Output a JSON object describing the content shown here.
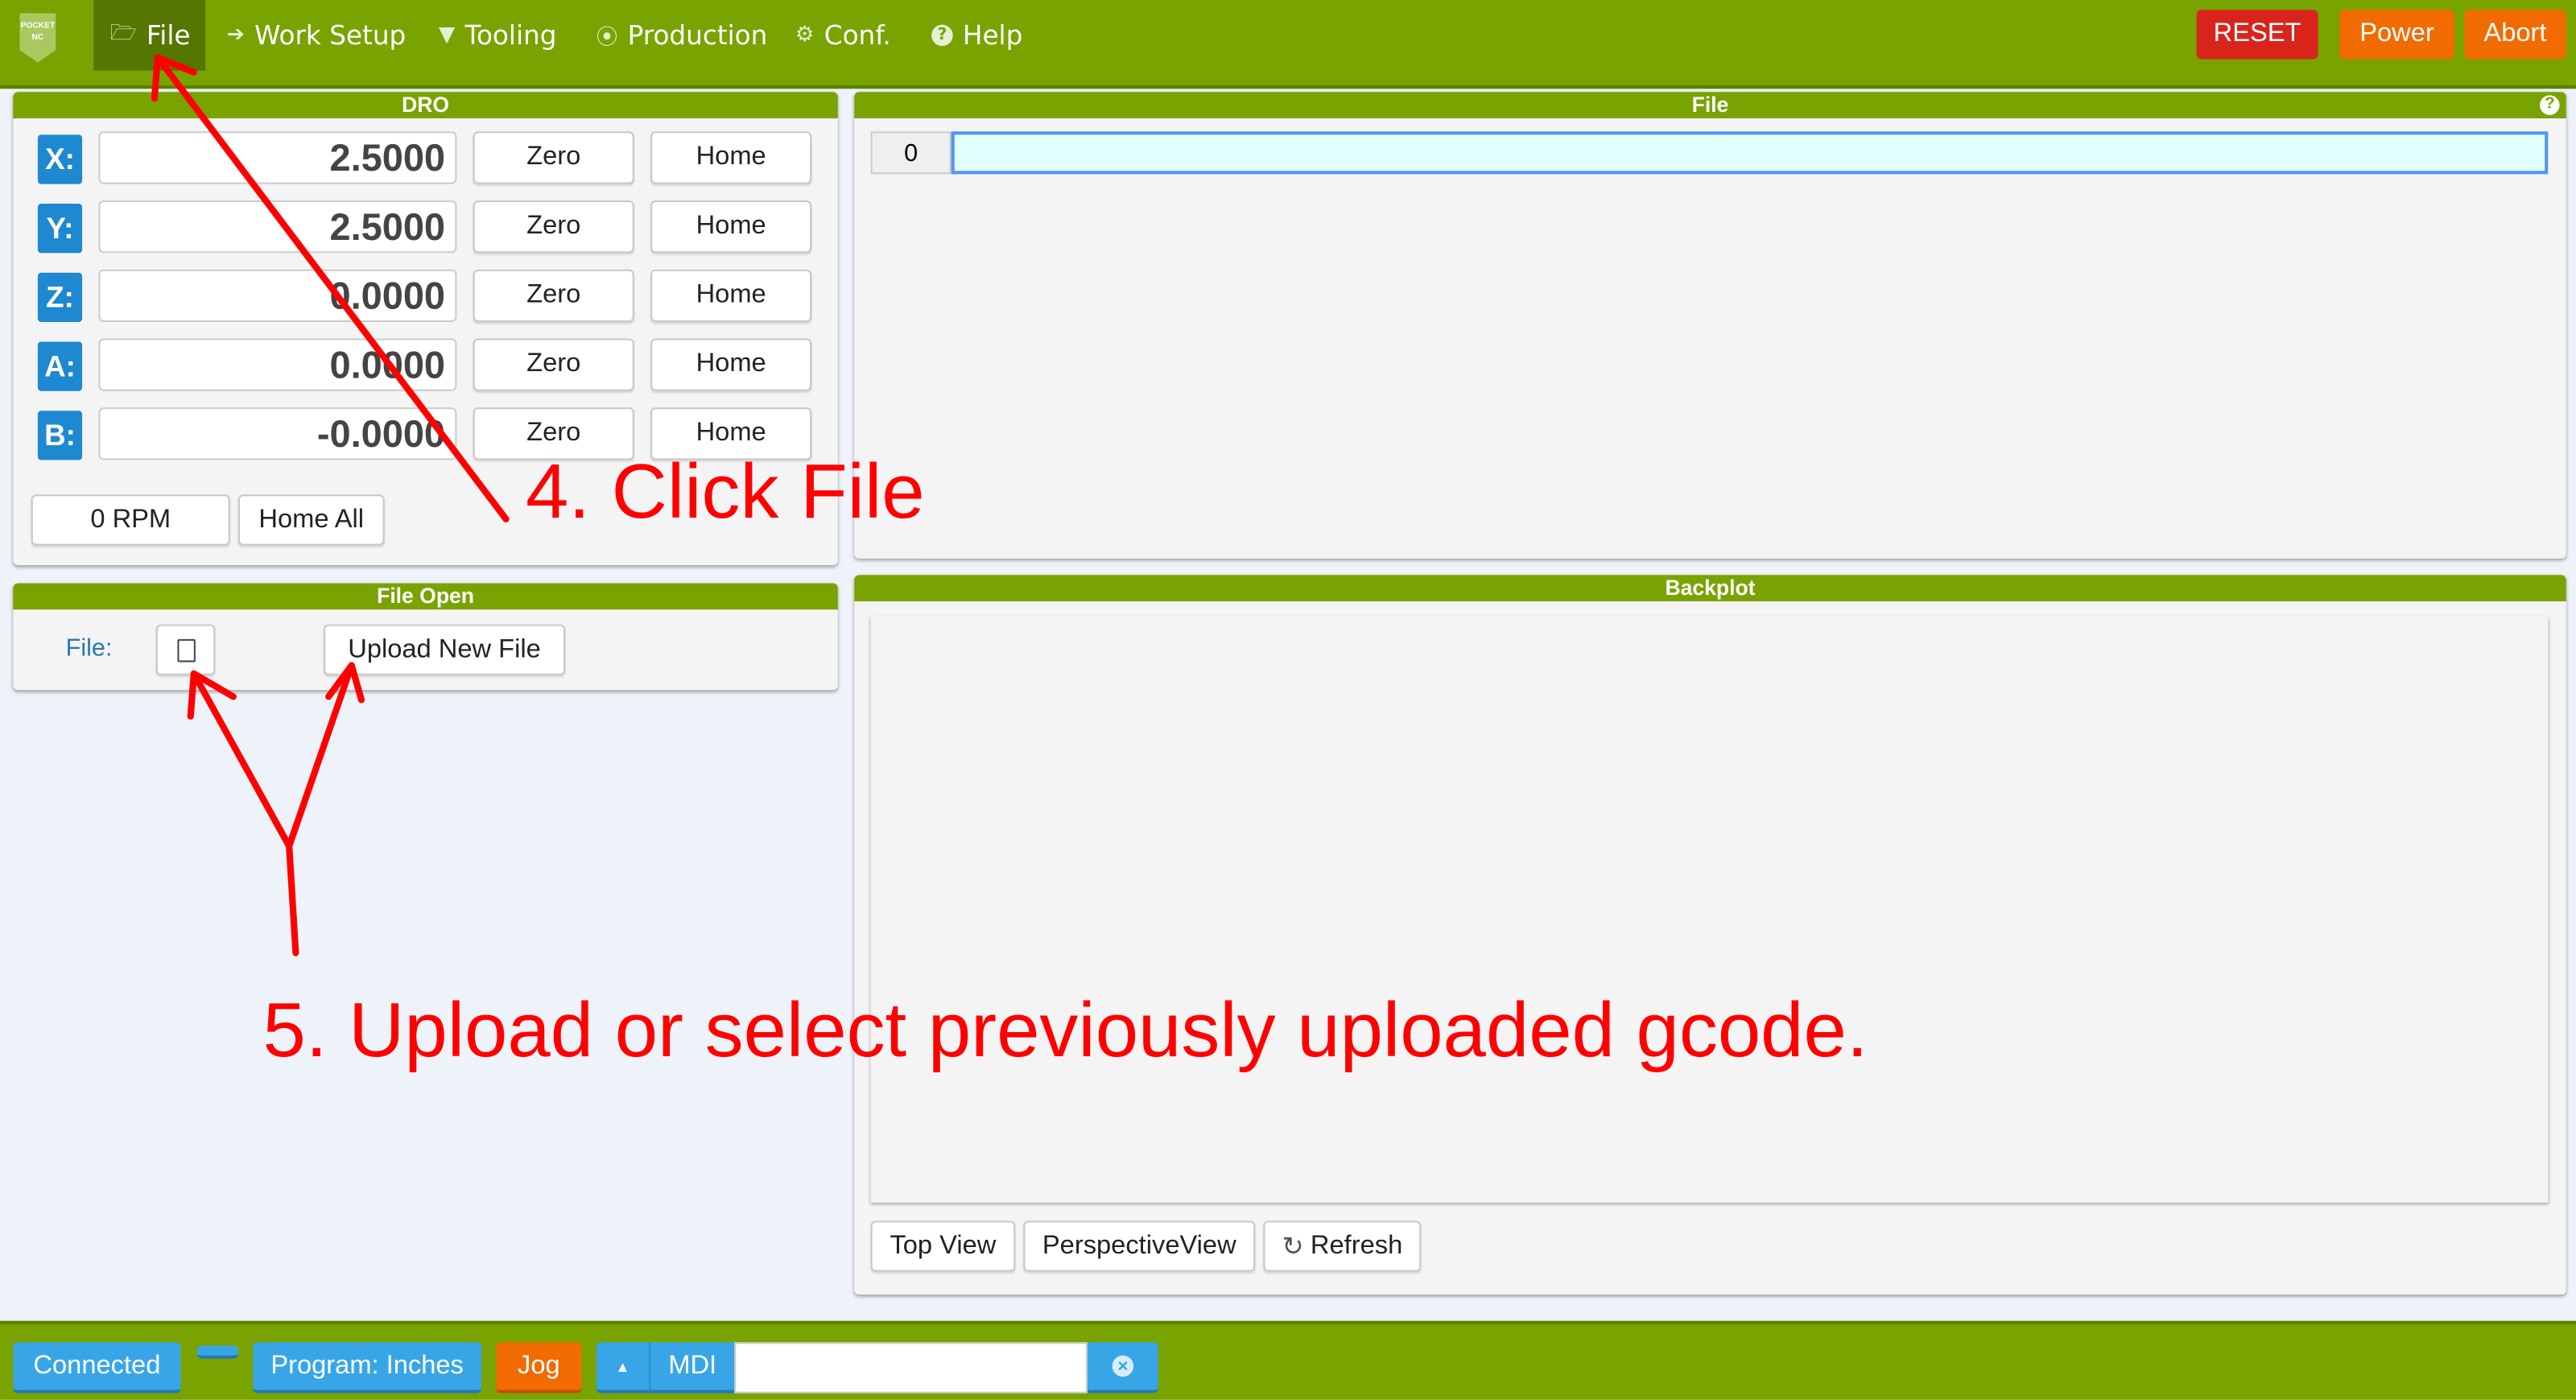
{
  "nav": {
    "logo": "POCKET NC",
    "items": [
      {
        "label": "File",
        "icon": "folder-open-icon",
        "glyph": "🗁"
      },
      {
        "label": "Work Setup",
        "icon": "sign-in-icon",
        "glyph": "➔"
      },
      {
        "label": "Tooling",
        "icon": "filter-icon",
        "glyph": "▼"
      },
      {
        "label": "Production",
        "icon": "play-circle-icon",
        "glyph": "▶"
      },
      {
        "label": "Conf.",
        "icon": "gears-icon",
        "glyph": "⚙"
      },
      {
        "label": "Help",
        "icon": "question-circle-icon",
        "glyph": "?"
      }
    ],
    "reset": "RESET",
    "power": "Power",
    "abort": "Abort"
  },
  "dro": {
    "title": "DRO",
    "rows": [
      {
        "axis": "X:",
        "value": "2.5000"
      },
      {
        "axis": "Y:",
        "value": "2.5000"
      },
      {
        "axis": "Z:",
        "value": "0.0000"
      },
      {
        "axis": "A:",
        "value": "0.0000"
      },
      {
        "axis": "B:",
        "value": "-0.0000"
      }
    ],
    "zero": "Zero",
    "home": "Home",
    "rpm": "0 RPM",
    "home_all": "Home All"
  },
  "file_open": {
    "title": "File Open",
    "label": "File:",
    "upload": "Upload New File"
  },
  "file_panel": {
    "title": "File",
    "help": "?",
    "line_number": "0",
    "line_text": ""
  },
  "backplot": {
    "title": "Backplot",
    "top_view": "Top View",
    "perspective_view": "PerspectiveView",
    "refresh": "Refresh"
  },
  "status": {
    "connected": "Connected",
    "program": "Program: Inches",
    "jog": "Jog",
    "up": "▲",
    "mdi": "MDI",
    "mdi_value": "",
    "clear": "×"
  },
  "annotations": {
    "step4": "4. Click File",
    "step5": "5. Upload or select previously uploaded gcode."
  },
  "colors": {
    "green": "#78a300",
    "reset": "#d9241c",
    "orange": "#f26b00",
    "blue": "#38a6e6",
    "annotation": "#ff0000"
  }
}
